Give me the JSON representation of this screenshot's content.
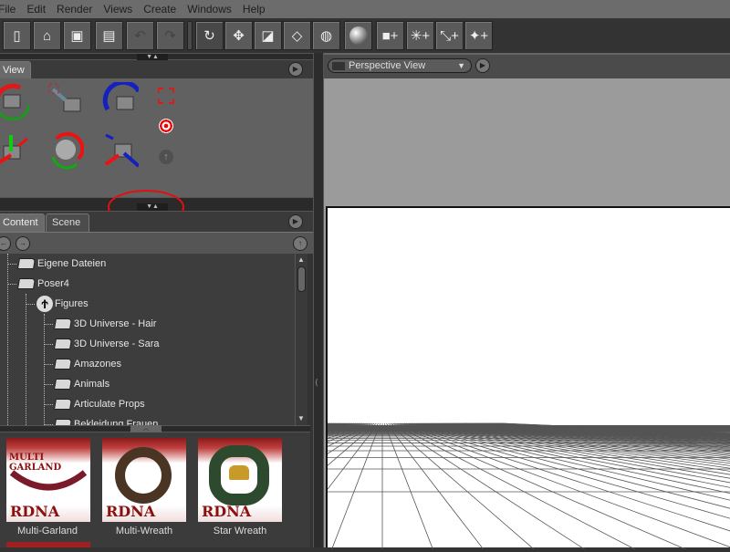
{
  "menu": [
    "File",
    "Edit",
    "Render",
    "Views",
    "Create",
    "Windows",
    "Help"
  ],
  "toolbar": {
    "buttons": [
      "new-file",
      "open-file",
      "save-file",
      "notes",
      "undo",
      "redo",
      "rotate-tool",
      "move-tool",
      "scale-tool",
      "eraser-tool",
      "universal-tool",
      "render-sphere",
      "add-camera",
      "add-light-distant",
      "add-light-point",
      "add-light-spot"
    ]
  },
  "view_panel": {
    "tab": "View",
    "controls": [
      "orbit-camera",
      "dolly-camera",
      "roll-camera",
      "frame-icon",
      "target-icon",
      "pan-camera",
      "rotate-camera",
      "translate-camera",
      "up-icon"
    ]
  },
  "content_panel": {
    "tabs": [
      "Content",
      "Scene"
    ],
    "tree": [
      {
        "label": "Eigene Dateien",
        "level": 0,
        "icon": "folder"
      },
      {
        "label": "Poser4",
        "level": 0,
        "icon": "folder"
      },
      {
        "label": "Figures",
        "level": 1,
        "icon": "figure"
      },
      {
        "label": "3D Universe - Hair",
        "level": 2,
        "icon": "folder"
      },
      {
        "label": "3D Universe - Sara",
        "level": 2,
        "icon": "folder"
      },
      {
        "label": "Amazones",
        "level": 2,
        "icon": "folder"
      },
      {
        "label": "Animals",
        "level": 2,
        "icon": "folder"
      },
      {
        "label": "Articulate Props",
        "level": 2,
        "icon": "folder"
      },
      {
        "label": "Bekleidung Frauen",
        "level": 2,
        "icon": "folder"
      }
    ],
    "thumbnails": [
      {
        "label": "Multi-Garland",
        "banner": "MULTI GARLAND",
        "brand": "RDNA"
      },
      {
        "label": "Multi-Wreath",
        "brand": "RDNA"
      },
      {
        "label": "Star Wreath",
        "brand": "RDNA"
      }
    ]
  },
  "viewport": {
    "camera": "Perspective View"
  },
  "colors": {
    "annotation": "#e01010"
  }
}
